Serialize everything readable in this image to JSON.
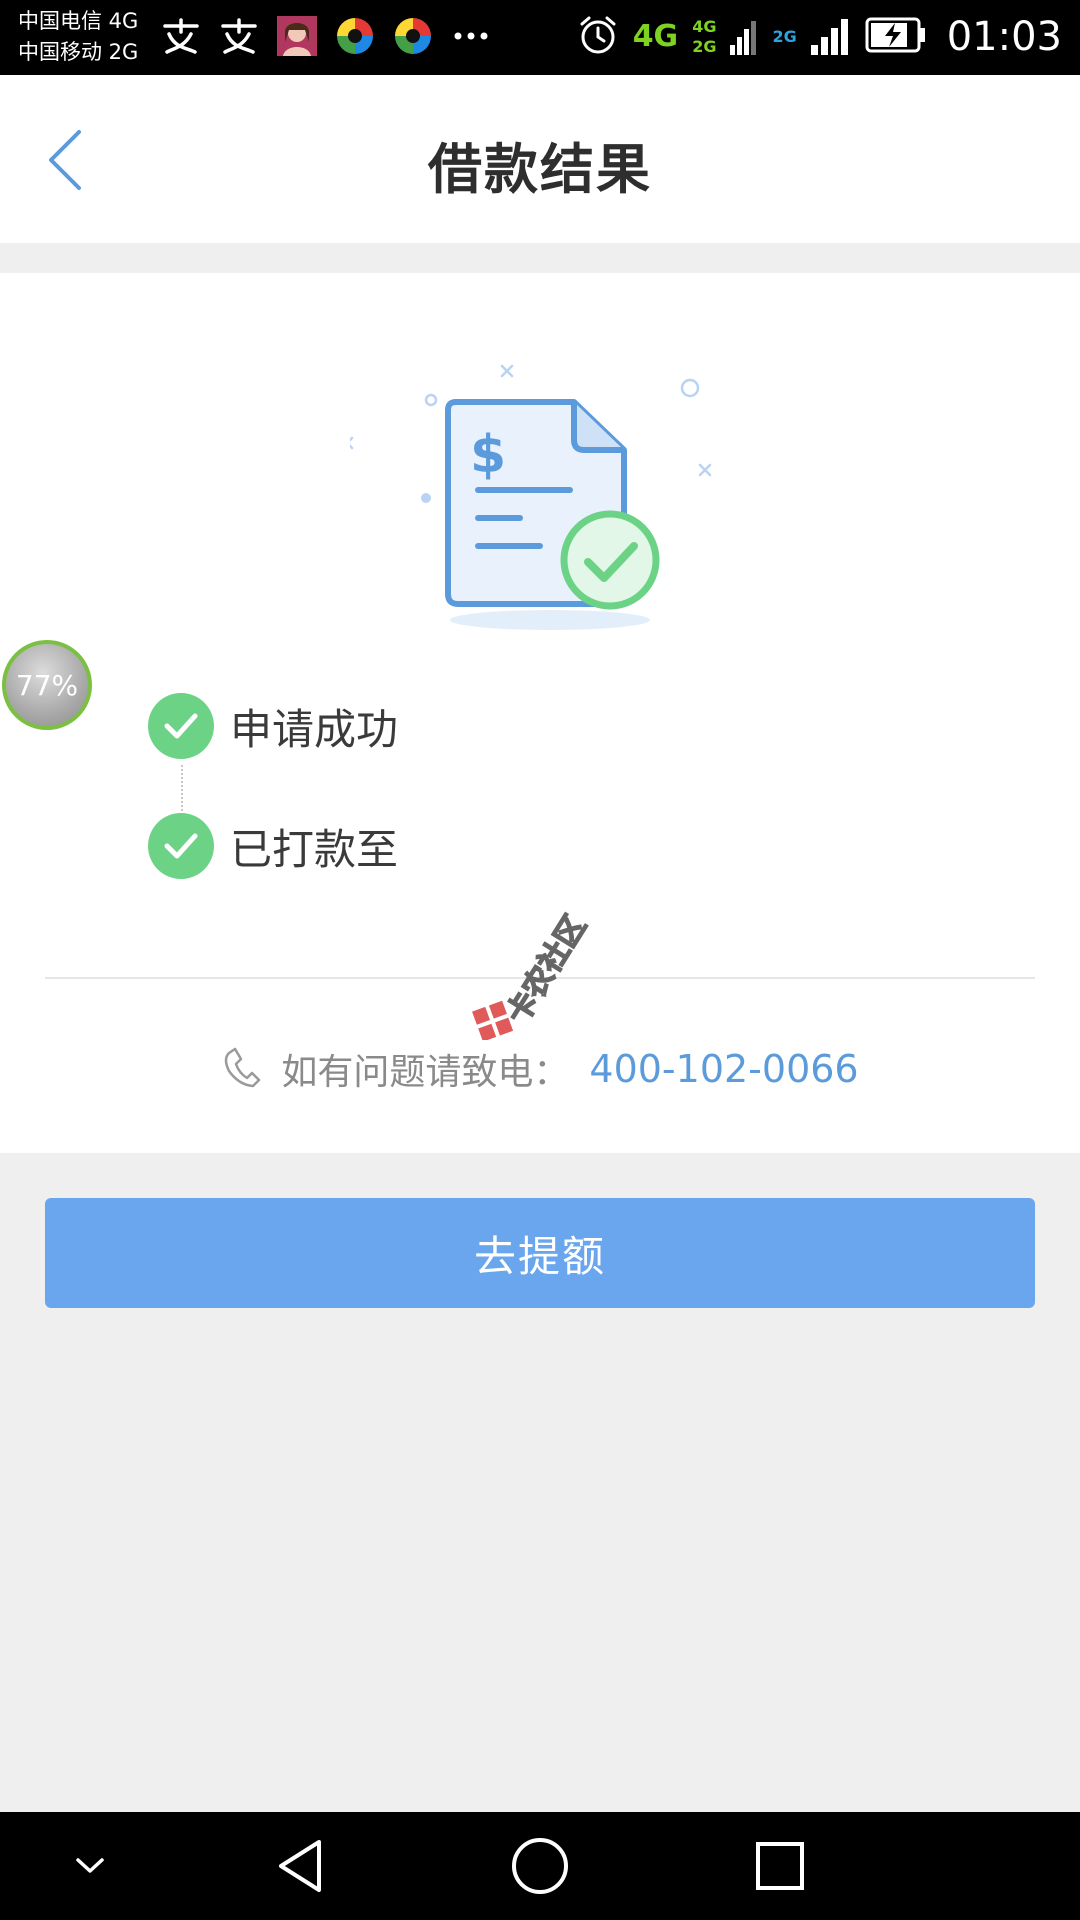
{
  "status_bar": {
    "carrier_1": "中国电信 4G",
    "carrier_2": "中国移动 2G",
    "notification_icons": [
      "alipay-icon",
      "alipay-icon",
      "avatar-icon",
      "app-ball-icon",
      "app-ball-icon",
      "more-icon"
    ],
    "network_main": "4G",
    "network_sim1": [
      "4G",
      "2G"
    ],
    "network_sim2": "2G",
    "time": "01:03"
  },
  "header": {
    "title": "借款结果"
  },
  "steps": [
    {
      "label": "申请成功"
    },
    {
      "label": "已打款至"
    }
  ],
  "contact": {
    "text": "如有问题请致电：",
    "phone": "400-102-0066"
  },
  "action": {
    "label": "去提额"
  },
  "badge": {
    "value": "77%"
  },
  "watermark": {
    "text": "卡农社区"
  },
  "colors": {
    "accent_blue": "#6aa6ee",
    "success_green": "#6cd386",
    "link_blue": "#5b9bdc"
  }
}
